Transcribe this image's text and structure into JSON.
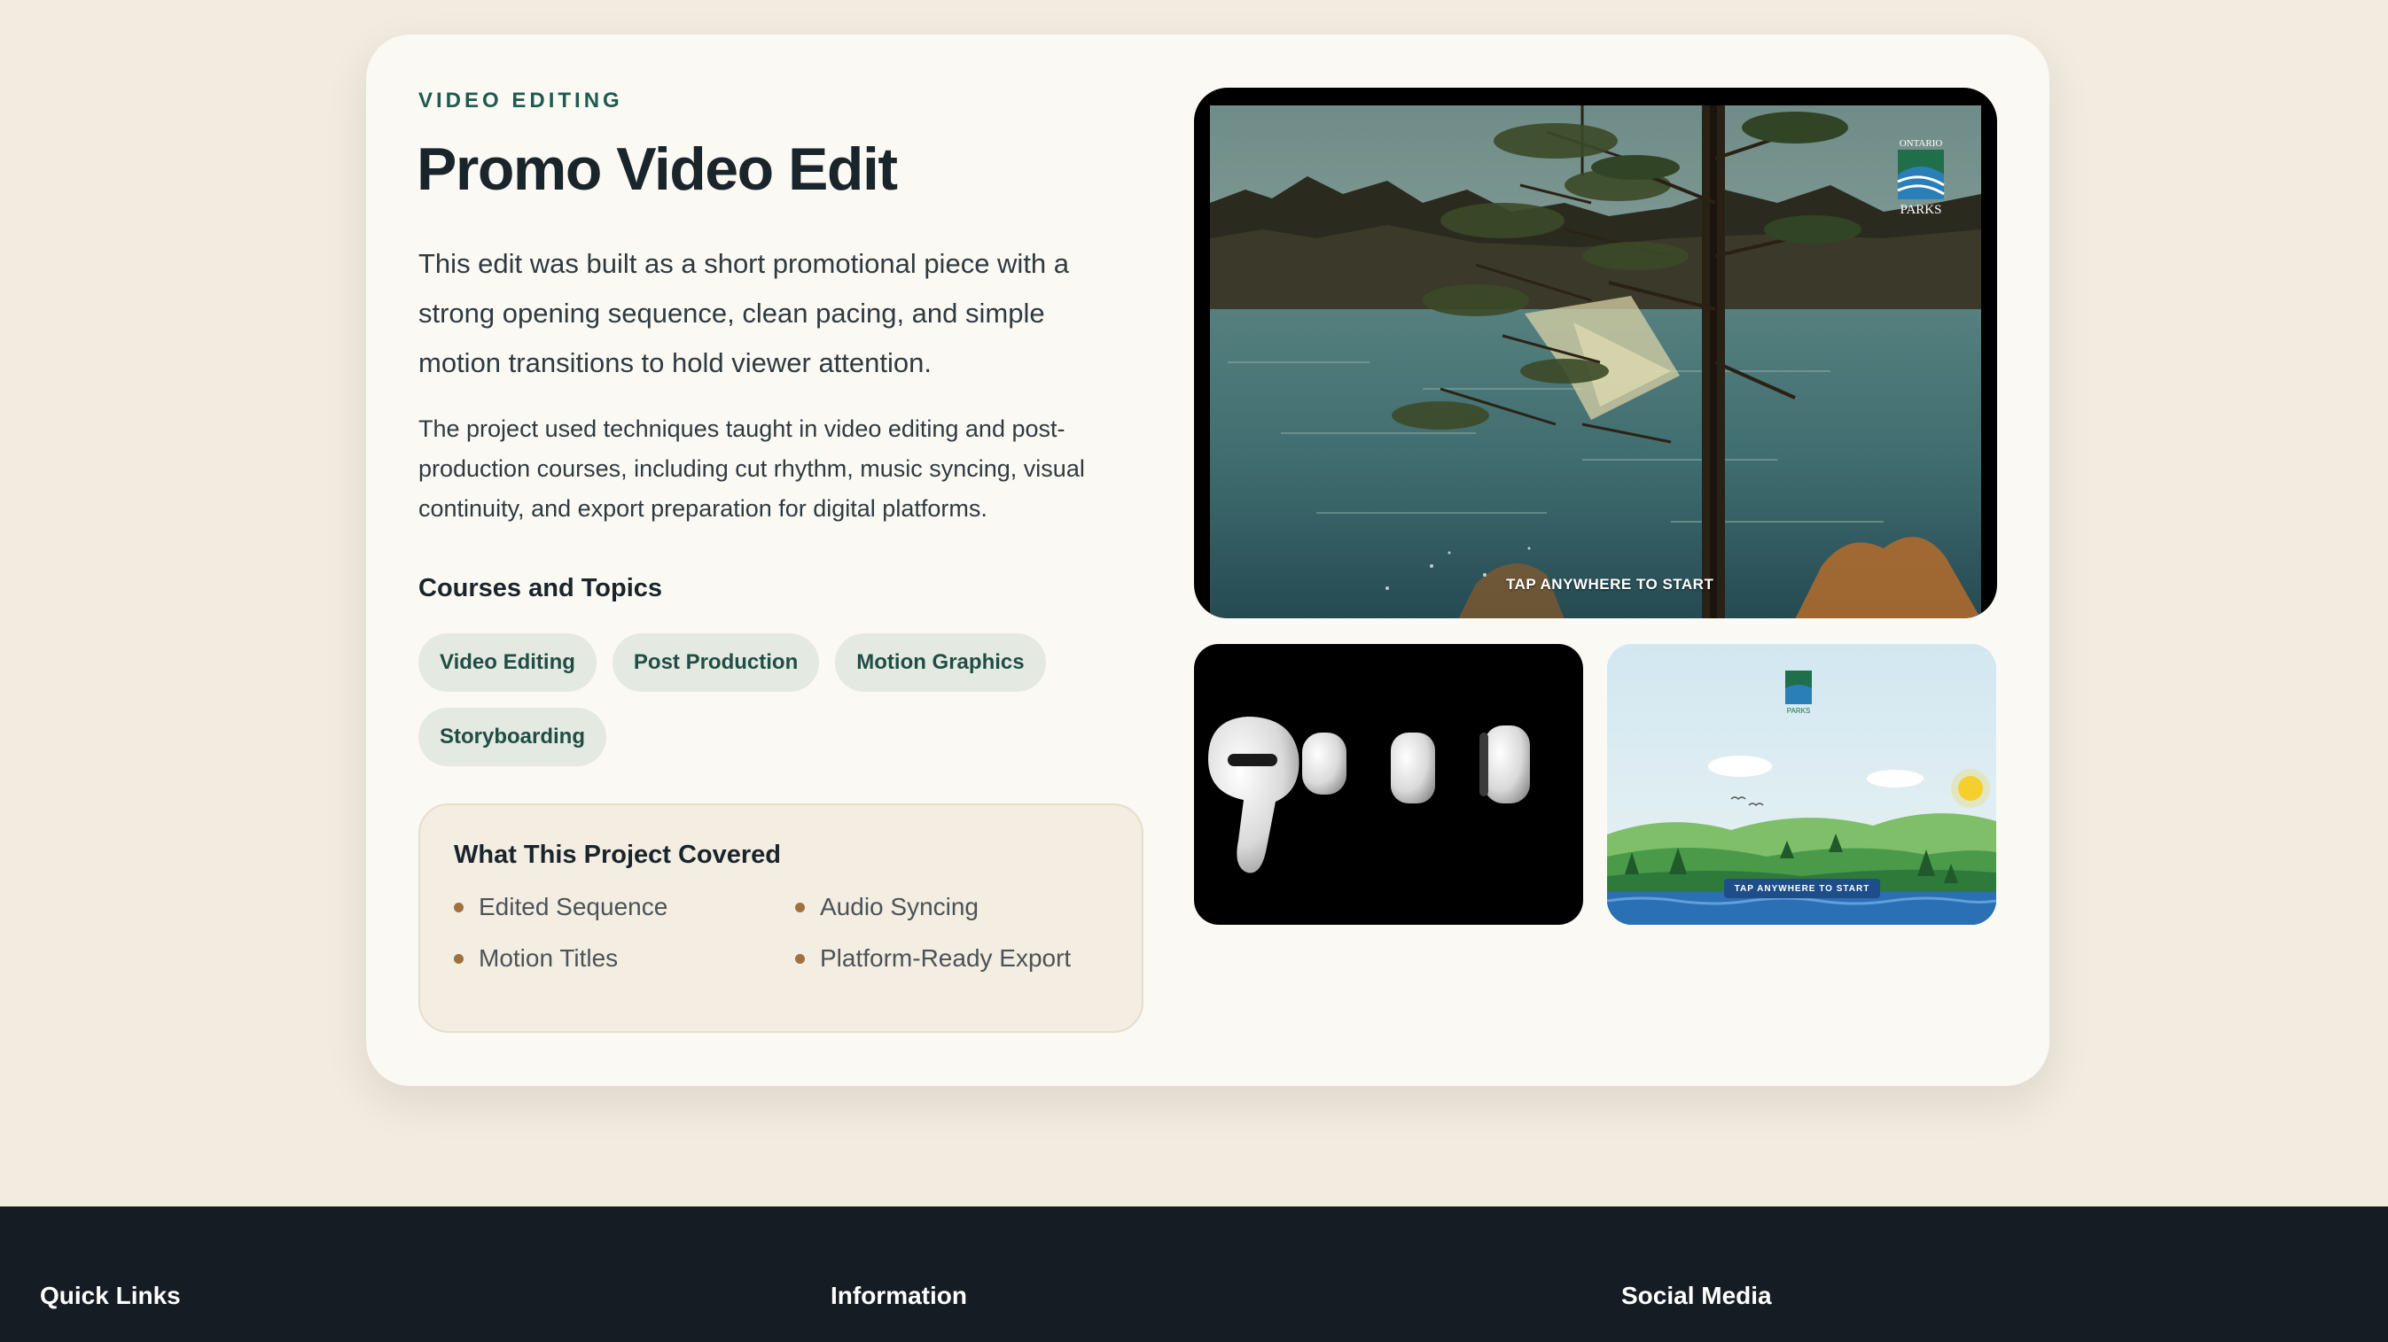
{
  "project": {
    "eyebrow": "VIDEO EDITING",
    "title": "Promo Video Edit",
    "lead": "This edit was built as a short promotional piece with a strong opening sequence, clean pacing, and simple motion transitions to hold viewer attention.",
    "body": "The project used techniques taught in video editing and post-production courses, including cut rhythm, music syncing, visual continuity, and export preparation for digital platforms.",
    "topics_heading": "Courses and Topics",
    "topics": [
      "Video Editing",
      "Post Production",
      "Motion Graphics",
      "Storyboarding"
    ],
    "covered": {
      "title": "What This Project Covered",
      "items": [
        "Edited Sequence",
        "Audio Syncing",
        "Motion Titles",
        "Platform-Ready Export"
      ]
    }
  },
  "media": {
    "main": {
      "logo_text_top": "ONTARIO",
      "logo_text_bottom": "PARKS",
      "overlay": "TAP ANYWHERE TO START"
    },
    "cartoon": {
      "logo_text": "PARKS",
      "overlay": "TAP ANYWHERE TO START"
    }
  },
  "colors": {
    "page_bg": "#f1ebe0",
    "card_bg": "#fbf9f4",
    "accent_green": "#1f5a4e",
    "chip_bg": "#e4e9e2",
    "bullet": "#a0703f",
    "footer_bg": "#151c24"
  },
  "footer": {
    "quick_links": "Quick Links",
    "information": "Information",
    "social_media": "Social Media"
  }
}
